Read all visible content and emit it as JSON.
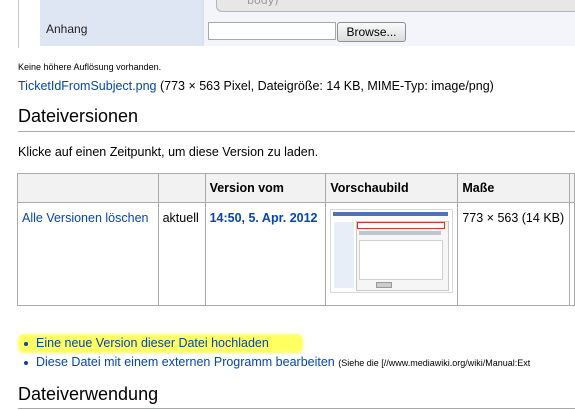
{
  "upload_form": {
    "textarea_hint": "body)",
    "attachment_label": "Anhang",
    "file_input_value": "",
    "browse_button": "Browse..."
  },
  "no_higher_resolution": "Keine höhere Auflösung vorhanden.",
  "file": {
    "name": "TicketIdFromSubject.png",
    "details": "(773 × 563 Pixel, Dateigröße: 14 KB, MIME-Typ: image/png)"
  },
  "versions_section": {
    "heading": "Dateiversionen",
    "instruction": "Klicke auf einen Zeitpunkt, um diese Version zu laden.",
    "table": {
      "headers": [
        "",
        "",
        "Version vom",
        "Vorschaubild",
        "Maße",
        ""
      ],
      "rows": [
        {
          "delete_all": "Alle Versionen löschen",
          "status": "aktuell",
          "date": "14:50, 5. Apr. 2012",
          "dimensions": "773 × 563 (14 KB)"
        }
      ]
    }
  },
  "actions": {
    "upload_new": "Eine neue Version dieser Datei hochladen",
    "edit_external": "Diese Datei mit einem externen Programm bearbeiten",
    "edit_external_note": "(Siehe die [//www.mediawiki.org/wiki/Manual:Ext"
  },
  "usage_section": {
    "heading": "Dateiverwendung"
  },
  "colors": {
    "link": "#0645ad",
    "highlight": "#ffff46",
    "header_bg": "#f2f2f2",
    "border": "#aaaaaa"
  }
}
